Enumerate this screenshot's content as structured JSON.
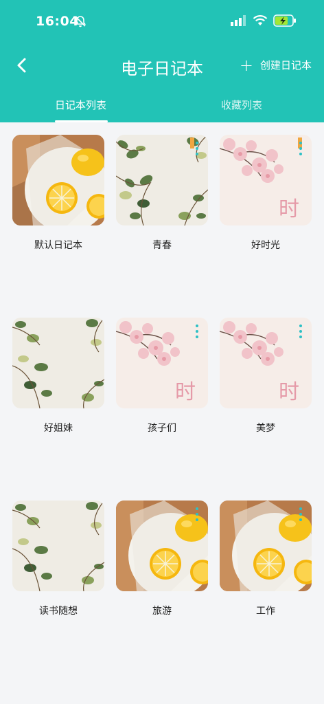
{
  "status": {
    "time": "16:04"
  },
  "header": {
    "title": "电子日记本",
    "create_label": "创建日记本"
  },
  "tabs": [
    {
      "label": "日记本列表",
      "active": true
    },
    {
      "label": "收藏列表",
      "active": false
    }
  ],
  "notebooks": [
    {
      "name": "默认日记本",
      "cover": "lemon"
    },
    {
      "name": "青春",
      "cover": "leaves"
    },
    {
      "name": "好时光",
      "cover": "blossom"
    },
    {
      "name": "好姐妹",
      "cover": "leaves"
    },
    {
      "name": "孩子们",
      "cover": "blossom"
    },
    {
      "name": "美梦",
      "cover": "blossom"
    },
    {
      "name": "读书随想",
      "cover": "leaves"
    },
    {
      "name": "旅游",
      "cover": "lemon"
    },
    {
      "name": "工作",
      "cover": "lemon"
    }
  ],
  "colors": {
    "accent": "#22c3b6",
    "background": "#f4f5f7",
    "menu_dots": "#2dc0c5"
  }
}
